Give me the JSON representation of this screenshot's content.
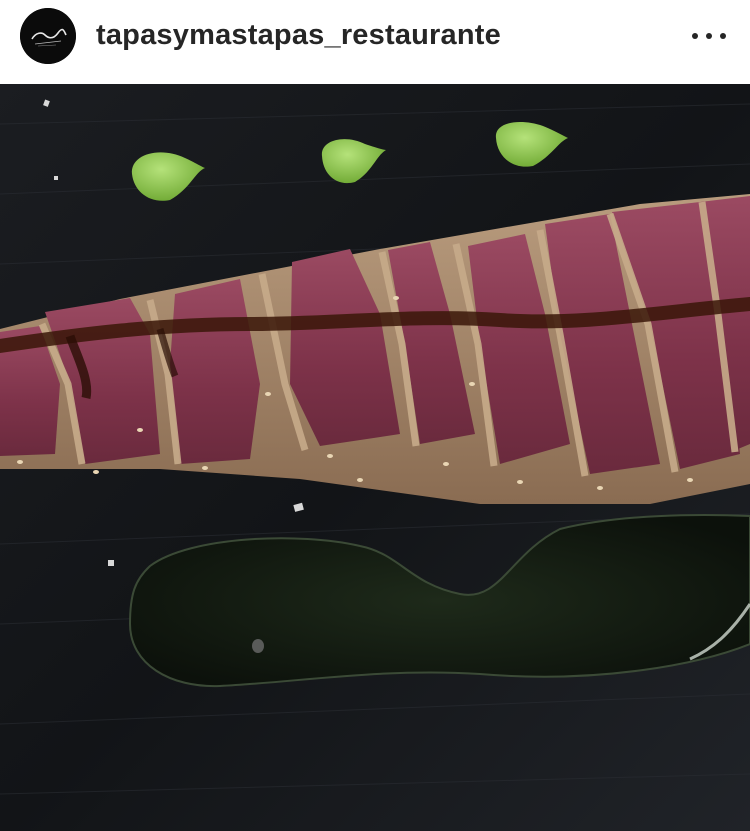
{
  "post": {
    "username": "tapasymastapas_restaurante",
    "more_icon": "more-horizontal-icon",
    "avatar_icon": "restaurant-logo"
  },
  "photo": {
    "subject": "seared-tuna-tataki-on-slate"
  },
  "colors": {
    "header_bg": "#ffffff",
    "username_text": "#262626",
    "slate": "#141619",
    "wasabi": "#8cc63f",
    "tuna": "#8a3c52"
  }
}
